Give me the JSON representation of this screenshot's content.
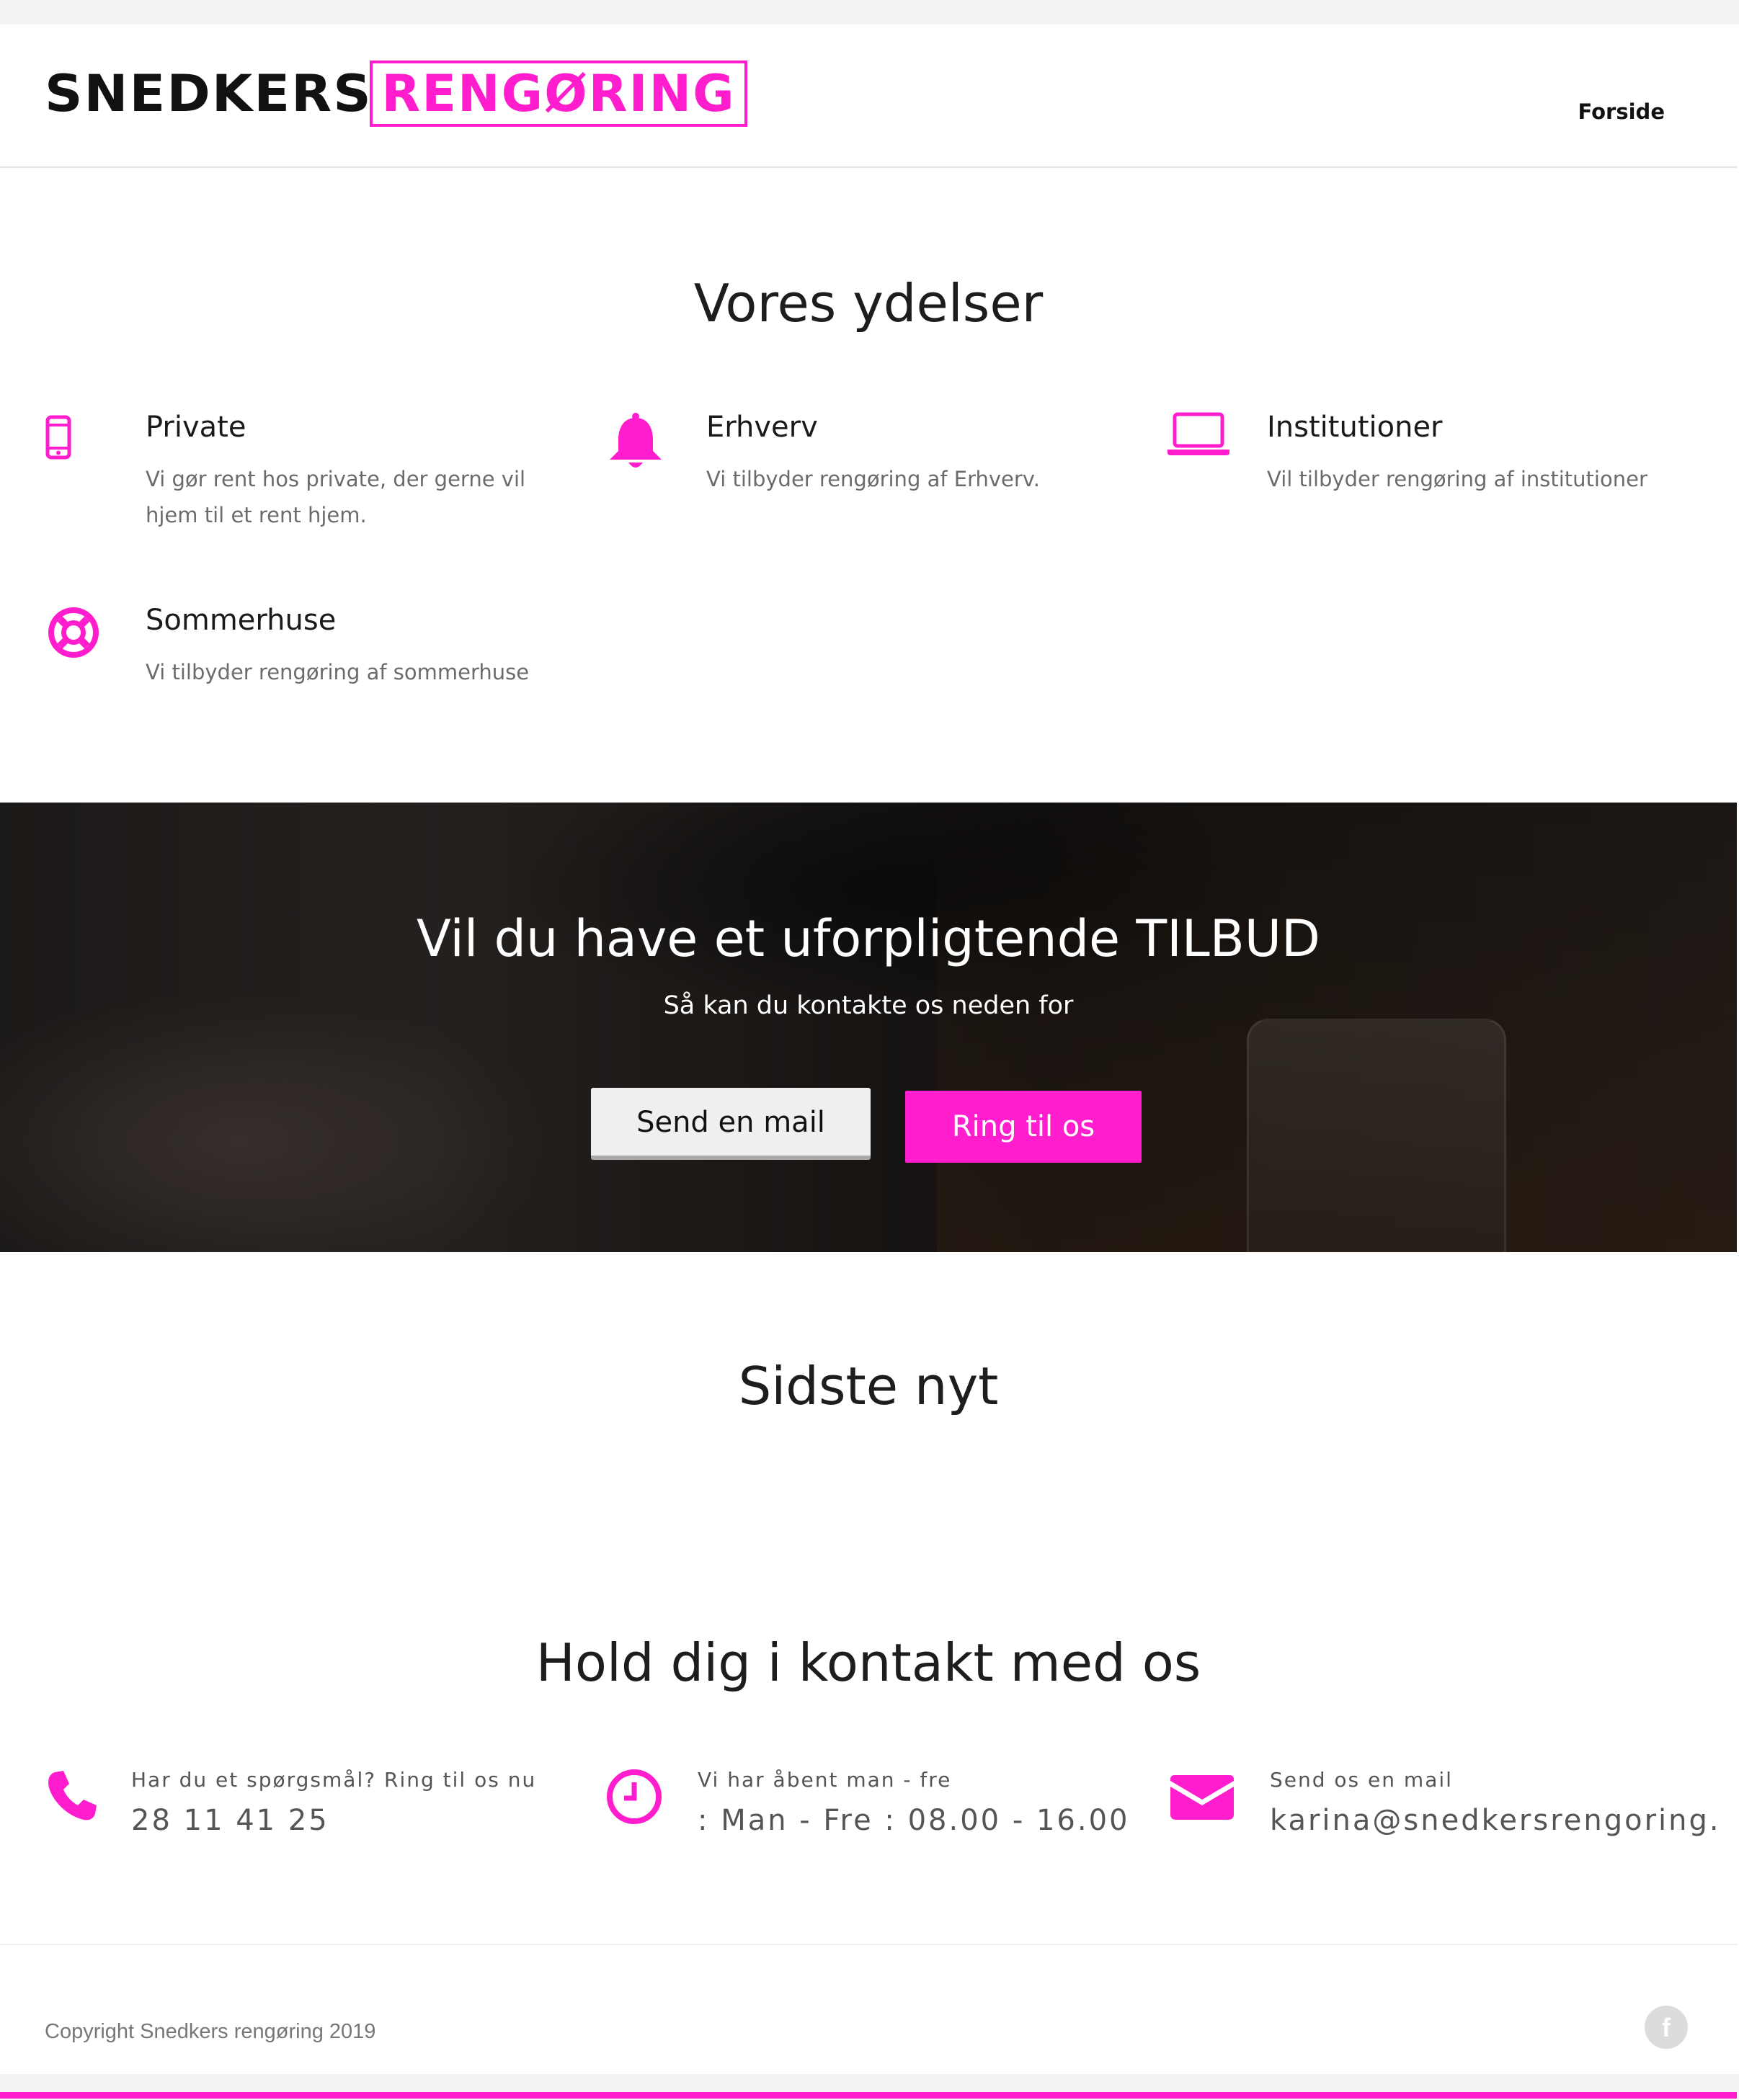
{
  "brand": {
    "logo_dark": "SNEDKERS",
    "logo_pink": "RENGØRING",
    "accent_color": "#ff1dce"
  },
  "nav": {
    "items": [
      {
        "label": "Forside"
      }
    ]
  },
  "services": {
    "heading": "Vores ydelser",
    "items": [
      {
        "icon": "mobile-phone-icon",
        "title": "Private",
        "description": "Vi gør rent hos private, der gerne vil hjem til et rent hjem."
      },
      {
        "icon": "bell-icon",
        "title": "Erhverv",
        "description": "Vi tilbyder rengøring af Erhverv."
      },
      {
        "icon": "laptop-icon",
        "title": "Institutioner",
        "description": "Vil tilbyder rengøring af institutioner"
      },
      {
        "icon": "life-ring-icon",
        "title": "Sommerhuse",
        "description": "Vi tilbyder rengøring af sommerhuse"
      }
    ]
  },
  "cta": {
    "heading": "Vil du have et uforpligtende TILBUD",
    "subheading": "Så kan du kontakte os neden for",
    "mail_button": "Send en mail",
    "call_button": "Ring til os"
  },
  "news": {
    "heading": "Sidste nyt"
  },
  "contact": {
    "heading": "Hold dig i kontakt med os",
    "items": [
      {
        "icon": "phone-icon",
        "label": "Har du et spørgsmål? Ring til os nu",
        "value": "28 11 41 25"
      },
      {
        "icon": "clock-icon",
        "label": "Vi har åbent man - fre",
        "value": ": Man - Fre : 08.00 - 16.00"
      },
      {
        "icon": "envelope-icon",
        "label": "Send os en mail",
        "value": "karina@snedkersrengoring."
      }
    ]
  },
  "footer": {
    "copyright": "Copyright Snedkers rengøring 2019",
    "social": [
      {
        "icon": "facebook-icon",
        "label": "f"
      }
    ]
  }
}
